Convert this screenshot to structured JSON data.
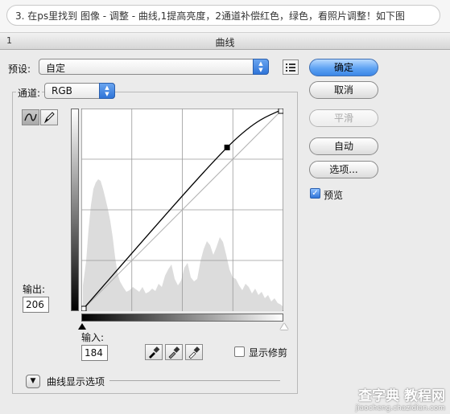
{
  "instruction": "3. 在ps里找到 图像 - 调整 - 曲线,1提高亮度，2通道补偿红色，绿色，看照片调整！如下图",
  "window": {
    "number": "1",
    "title": "曲线"
  },
  "preset": {
    "label": "预设:",
    "value": "自定"
  },
  "channel": {
    "label": "通道:",
    "value": "RGB"
  },
  "buttons": {
    "ok": "确定",
    "cancel": "取消",
    "smooth": "平滑",
    "auto": "自动",
    "options": "选项..."
  },
  "preview": {
    "label": "预览",
    "checked": true
  },
  "output": {
    "label": "输出:",
    "value": "206"
  },
  "input": {
    "label": "输入:",
    "value": "184"
  },
  "show_clipping": {
    "label": "显示修剪",
    "checked": false
  },
  "curve_display_options": "曲线显示选项",
  "curve": {
    "points": [
      [
        0,
        0
      ],
      [
        184,
        206
      ],
      [
        255,
        255
      ]
    ]
  },
  "watermark": {
    "line1": "查字典 教程网",
    "line2": "jiaocheng.chazidian.com"
  },
  "colors": {
    "accent": "#3b86e6",
    "grid": "#9a9a9a",
    "histogram": "#d9d9d9"
  }
}
